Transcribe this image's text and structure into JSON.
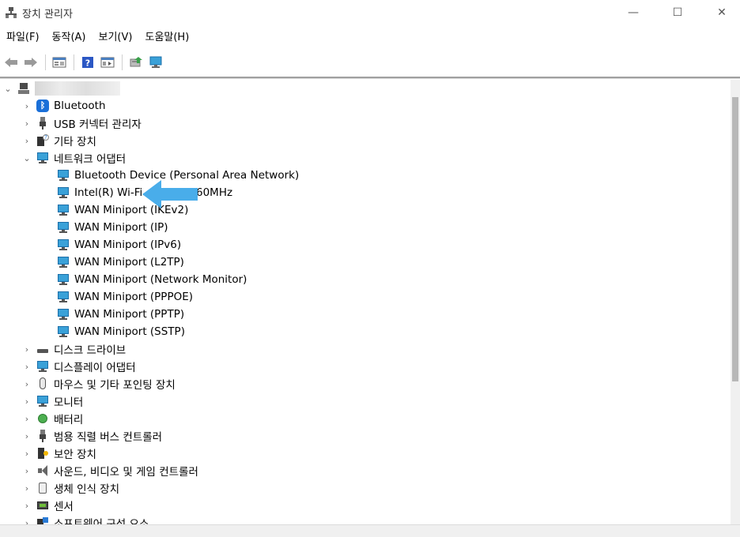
{
  "window": {
    "title": "장치 관리자",
    "minimize_glyph": "—",
    "maximize_glyph": "☐",
    "close_glyph": "✕"
  },
  "menu": [
    "파일(F)",
    "동작(A)",
    "보기(V)",
    "도움말(H)"
  ],
  "toolbar": {
    "icons": [
      "back-arrow-icon",
      "forward-arrow-icon",
      "properties-icon",
      "help-icon",
      "view-icon",
      "update-driver-icon",
      "scan-hardware-icon"
    ]
  },
  "tree": {
    "root_expander": "⌄",
    "collapsed_glyph": "›",
    "expanded_glyph": "⌄",
    "categories": [
      {
        "label": "Bluetooth",
        "icon": "bluetooth-icon"
      },
      {
        "label": "USB 커넥터 관리자",
        "icon": "usb-icon"
      },
      {
        "label": "기타 장치",
        "icon": "other-devices-icon"
      },
      {
        "label": "네트워크 어댑터",
        "icon": "network-adapter-icon",
        "expanded": true
      },
      {
        "label": "디스크 드라이브",
        "icon": "disk-drive-icon"
      },
      {
        "label": "디스플레이 어댑터",
        "icon": "display-adapter-icon"
      },
      {
        "label": "마우스 및 기타 포인팅 장치",
        "icon": "mouse-icon"
      },
      {
        "label": "모니터",
        "icon": "monitor-icon"
      },
      {
        "label": "배터리",
        "icon": "battery-icon"
      },
      {
        "label": "범용 직렬 버스 컨트롤러",
        "icon": "usb-controller-icon"
      },
      {
        "label": "보안 장치",
        "icon": "security-device-icon"
      },
      {
        "label": "사운드, 비디오 및 게임 컨트롤러",
        "icon": "audio-icon"
      },
      {
        "label": "생체 인식 장치",
        "icon": "biometric-icon"
      },
      {
        "label": "센서",
        "icon": "sensor-icon"
      },
      {
        "label": "소프트웨어 구성 요소",
        "icon": "software-component-icon"
      }
    ],
    "network_adapters": [
      "Bluetooth Device (Personal Area Network)",
      "Intel(R) Wi-Fi",
      "WAN Miniport (IKEv2)",
      "WAN Miniport (IP)",
      "WAN Miniport (IPv6)",
      "WAN Miniport (L2TP)",
      "WAN Miniport (Network Monitor)",
      "WAN Miniport (PPPOE)",
      "WAN Miniport (PPTP)",
      "WAN Miniport (SSTP)"
    ],
    "wifi_suffix": "60MHz"
  },
  "colors": {
    "arrow": "#3aa6e8",
    "network_icon": "#3aa1d8"
  }
}
